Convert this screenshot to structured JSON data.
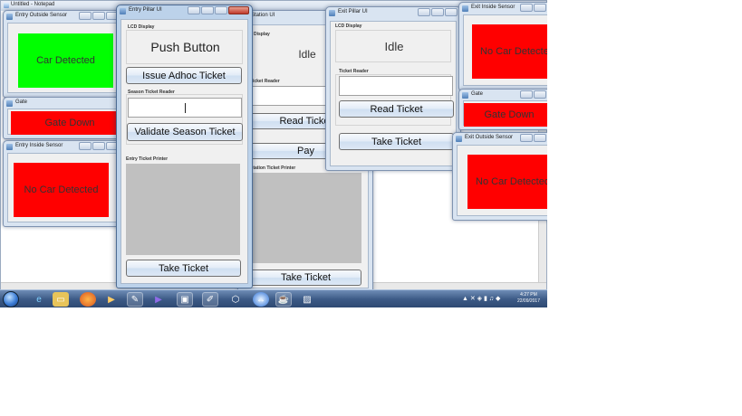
{
  "notepad": {
    "title": "Untitled - Notepad"
  },
  "entry_outside_sensor": {
    "title": "Entry Outside Sensor",
    "status": "Car Detected"
  },
  "gate_left": {
    "title": "Gate",
    "status": "Gate Down"
  },
  "entry_inside_sensor": {
    "title": "Entry Inside Sensor",
    "status": "No Car Detected"
  },
  "entry_pillar": {
    "title": "Entry Pillar UI",
    "lcd_label": "LCD Display",
    "lcd_text": "Push Button",
    "issue_button": "Issue Adhoc Ticket",
    "season_label": "Season Ticket Reader",
    "season_input": "",
    "validate_button": "Validate Season Ticket",
    "printer_label": "Entry Ticket Printer",
    "take_button": "Take Ticket"
  },
  "pay_station": {
    "title": "Station UI",
    "lcd_label": "Display",
    "lcd_text": "Idle",
    "reader_label": "Ticket Reader",
    "read_button": "Read Ticket",
    "pay_button": "Pay",
    "printer_label": "Station Ticket Printer",
    "take_button": "Take Ticket"
  },
  "exit_pillar": {
    "title": "Exit Pillar UI",
    "lcd_label": "LCD Display",
    "lcd_text": "Idle",
    "reader_label": "Ticket Reader",
    "reader_input": "",
    "read_button": "Read Ticket",
    "take_button": "Take Ticket"
  },
  "exit_inside_sensor": {
    "title": "Exit Inside Sensor",
    "status": "No Car Detected"
  },
  "gate_right": {
    "title": "Gate",
    "status": "Gate Down"
  },
  "exit_outside_sensor": {
    "title": "Exit Outside Sensor",
    "status": "No Car Detected"
  },
  "taskbar": {
    "time": "4:27 PM",
    "date": "22/09/2017"
  },
  "colors": {
    "red": "#ff0000",
    "green": "#00ff00",
    "grey": "#c0c0c0"
  }
}
